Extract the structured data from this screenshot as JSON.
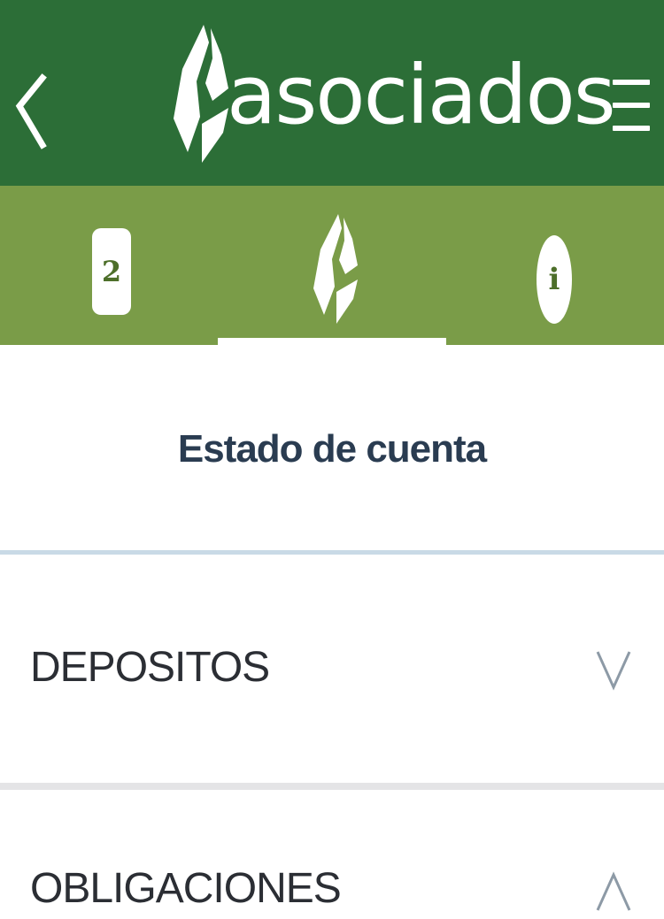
{
  "header": {
    "brand_name": "asociados",
    "colors": {
      "background": "#2c6e37",
      "foreground": "#ffffff"
    },
    "back_icon": "chevron-left-icon",
    "menu_icon": "hamburger-menu-icon"
  },
  "tabs": {
    "background": "#7a9c48",
    "items": [
      {
        "id": "notifications",
        "badge": "2",
        "icon": "badge-icon"
      },
      {
        "id": "home",
        "icon": "brand-logo-icon",
        "selected": true
      },
      {
        "id": "info",
        "label": "i",
        "icon": "info-icon"
      }
    ]
  },
  "main": {
    "title": "Estado de cuenta",
    "sections": [
      {
        "label": "DEPOSITOS",
        "state": "collapsed",
        "icon": "chevron-down-icon"
      },
      {
        "label": "OBLIGACIONES",
        "state": "expanded",
        "icon": "chevron-up-icon"
      }
    ]
  }
}
